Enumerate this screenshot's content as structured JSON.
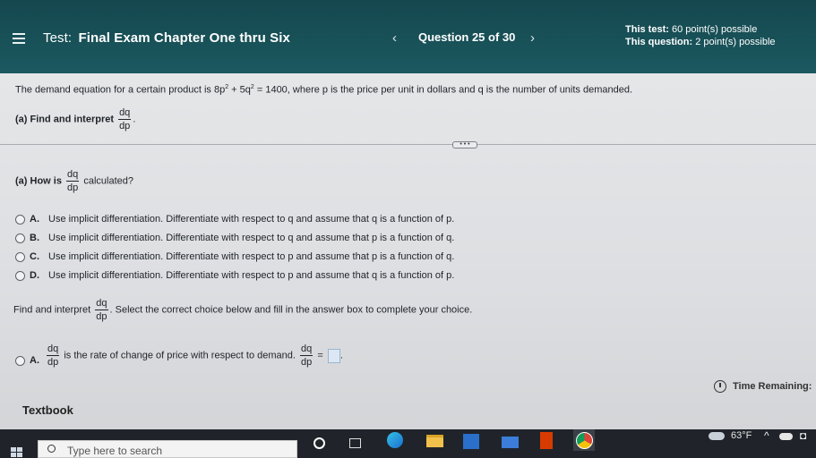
{
  "header": {
    "test_prefix": "Test:",
    "test_name": "Final Exam Chapter One thru Six",
    "prev_icon": "‹",
    "next_icon": "›",
    "question_counter": "Question 25 of 30",
    "test_points_label": "This test:",
    "test_points_value": "60 point(s) possible",
    "question_points_label": "This question:",
    "question_points_value": "2 point(s) possible"
  },
  "problem": {
    "statement_pre": "The demand equation for a certain product is 8p",
    "exp1": "2",
    "statement_mid": " + 5q",
    "exp2": "2",
    "statement_post": " = 1400, where p is the price per unit in dollars and q is the number of units demanded.",
    "part_a_label": "(a) Find and interpret",
    "frac_num": "dq",
    "frac_den": "dp",
    "part_a_end": "."
  },
  "more_button": "• • •",
  "question": {
    "label_pre": "(a) How is",
    "label_post": "calculated?",
    "frac_num": "dq",
    "frac_den": "dp"
  },
  "options": [
    {
      "letter": "A.",
      "text": "Use implicit differentiation. Differentiate with respect to q and assume that q is a function of p."
    },
    {
      "letter": "B.",
      "text": "Use implicit differentiation. Differentiate with respect to q and assume that p is a function of q."
    },
    {
      "letter": "C.",
      "text": "Use implicit differentiation. Differentiate with respect to p and assume that p is a function of q."
    },
    {
      "letter": "D.",
      "text": "Use implicit differentiation. Differentiate with respect to p and assume that q is a function of p."
    }
  ],
  "interpret": {
    "pre": "Find and interpret",
    "frac_num": "dq",
    "frac_den": "dp",
    "post": ". Select the correct choice below and fill in the answer box to complete your choice."
  },
  "choice_a": {
    "letter": "A.",
    "frac_num": "dq",
    "frac_den": "dp",
    "text": "is the rate of change of price with respect to demand.",
    "frac2_num": "dq",
    "frac2_den": "dp",
    "equals": "=",
    "end": "."
  },
  "time_remaining_label": "Time Remaining:",
  "textbook_label": "Textbook",
  "taskbar": {
    "search_placeholder": "Type here to search",
    "weather_temp": "63°F",
    "tray_chevron": "^"
  }
}
